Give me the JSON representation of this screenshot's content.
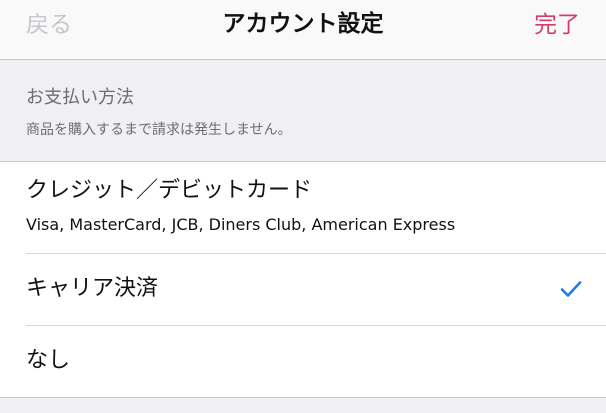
{
  "navbar": {
    "back_label": "戻る",
    "title": "アカウント設定",
    "done_label": "完了"
  },
  "payment_section": {
    "title": "お支払い方法",
    "footnote": "商品を購入するまで請求は発生しません。"
  },
  "payment_options": [
    {
      "label": "クレジット／デビットカード",
      "sublabel": "Visa, MasterCard, JCB, Diners Club, American Express",
      "selected": false
    },
    {
      "label": "キャリア決済",
      "selected": true
    },
    {
      "label": "なし",
      "selected": false
    }
  ],
  "colors": {
    "accent_done": "#d83a6a",
    "checkmark": "#1f7af5",
    "back_disabled": "#c6c6cb"
  },
  "icons": {
    "selected_marker": "checkmark-icon"
  }
}
